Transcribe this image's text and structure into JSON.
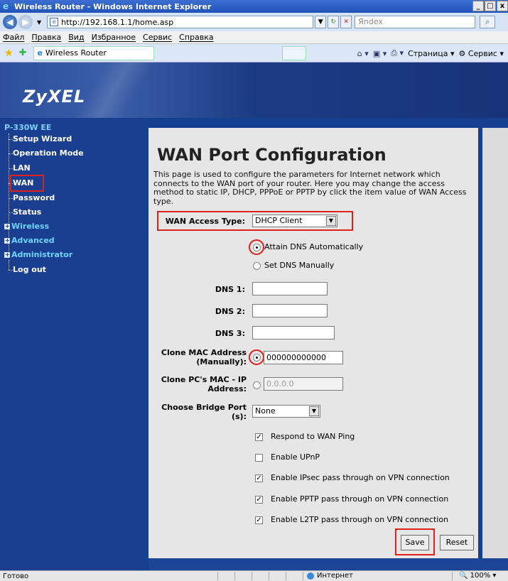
{
  "window": {
    "title": "Wireless Router - Windows Internet Explorer",
    "controls": [
      "_",
      "□",
      "x"
    ]
  },
  "addressbar": {
    "url": "http://192.168.1.1/home.asp",
    "search_placeholder": "Яndex"
  },
  "menu": [
    "Файл",
    "Правка",
    "Вид",
    "Избранное",
    "Сервис",
    "Справка"
  ],
  "favorites": {
    "tab_label": "Wireless Router",
    "page_label": "Страница",
    "service_label": "Сервис"
  },
  "brand": {
    "logo": "ZyXEL"
  },
  "sidebar": {
    "model": "P-330W EE",
    "items": [
      {
        "label": "Setup Wizard",
        "type": "leaf"
      },
      {
        "label": "Operation Mode",
        "type": "leaf"
      },
      {
        "label": "LAN",
        "type": "leaf"
      },
      {
        "label": "WAN",
        "type": "leaf",
        "highlighted": true
      },
      {
        "label": "Password",
        "type": "leaf"
      },
      {
        "label": "Status",
        "type": "leaf"
      },
      {
        "label": "Wireless",
        "type": "category"
      },
      {
        "label": "Advanced",
        "type": "category"
      },
      {
        "label": "Administrator",
        "type": "category"
      },
      {
        "label": "Log out",
        "type": "leaf"
      }
    ]
  },
  "page": {
    "title": "WAN Port Configuration",
    "description": "This page is used to configure the parameters for Internet network which connects to the WAN port of your router. Here you may change the access method to static IP, DHCP, PPPoE or PPTP by click the item value of WAN Access type."
  },
  "form": {
    "wan_access_type_label": "WAN Access Type:",
    "wan_access_type_value": "DHCP Client",
    "dns_auto_label": "Attain DNS Automatically",
    "dns_manual_label": "Set DNS Manually",
    "dns1_label": "DNS 1:",
    "dns2_label": "DNS 2:",
    "dns3_label": "DNS 3:",
    "dns1_value": "",
    "dns2_value": "",
    "dns3_value": "",
    "clone_mac_label_1": "Clone MAC Address",
    "clone_mac_label_2": "(Manually):",
    "clone_mac_value": "000000000000",
    "clone_pc_label_1": "Clone PC's MAC - IP",
    "clone_pc_label_2": "Address:",
    "clone_pc_value": "0.0.0.0",
    "bridge_label_1": "Choose Bridge Port",
    "bridge_label_2": "(s):",
    "bridge_value": "None",
    "checkboxes": [
      {
        "label": "Respond to WAN Ping",
        "checked": true
      },
      {
        "label": "Enable UPnP",
        "checked": false
      },
      {
        "label": "Enable IPsec pass through on VPN connection",
        "checked": true
      },
      {
        "label": "Enable PPTP pass through on VPN connection",
        "checked": true
      },
      {
        "label": "Enable L2TP pass through on VPN connection",
        "checked": true
      }
    ],
    "save_label": "Save",
    "reset_label": "Reset"
  },
  "statusbar": {
    "status": "Готово",
    "zone": "Интернет",
    "zoom": "100%"
  }
}
